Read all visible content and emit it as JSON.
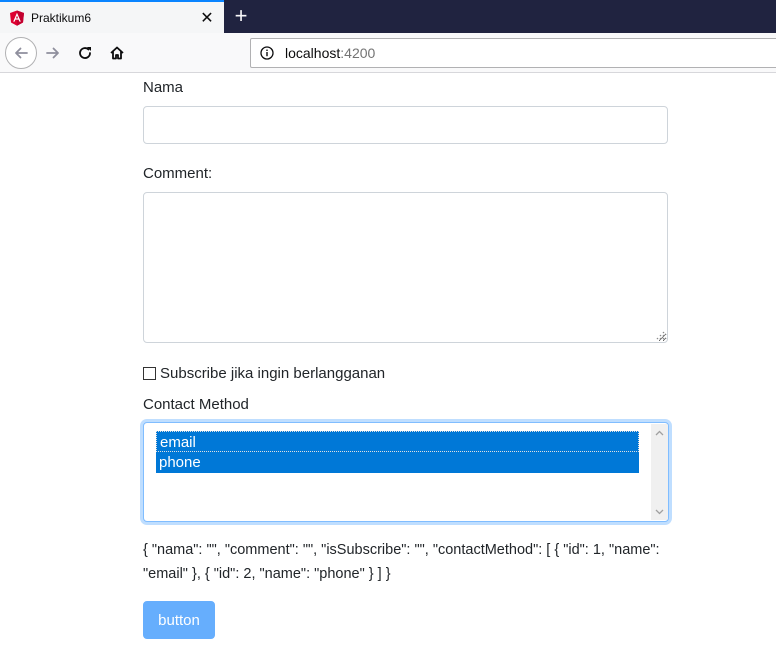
{
  "browser": {
    "tab_title": "Praktikum6",
    "tab_close": "✕",
    "new_tab": "+",
    "url_host": "localhost",
    "url_port": ":4200",
    "accent_color": "#0a84ff",
    "tabbar_color": "#202340"
  },
  "form": {
    "nama_label": "Nama",
    "nama_value": "",
    "comment_label": "Comment:",
    "comment_value": "",
    "subscribe_label": "Subscribe jika ingin berlangganan",
    "subscribe_checked": false,
    "contact_label": "Contact Method",
    "contact_options": [
      "email",
      "phone"
    ],
    "json_output": "{ \"nama\": \"\", \"comment\": \"\", \"isSubscribe\": \"\", \"contactMethod\": [ { \"id\": 1, \"name\": \"email\" }, { \"id\": 2, \"name\": \"phone\" } ] }",
    "submit_label": "button",
    "option_selected_color": "#0078d7",
    "button_color": "#66aefd"
  }
}
